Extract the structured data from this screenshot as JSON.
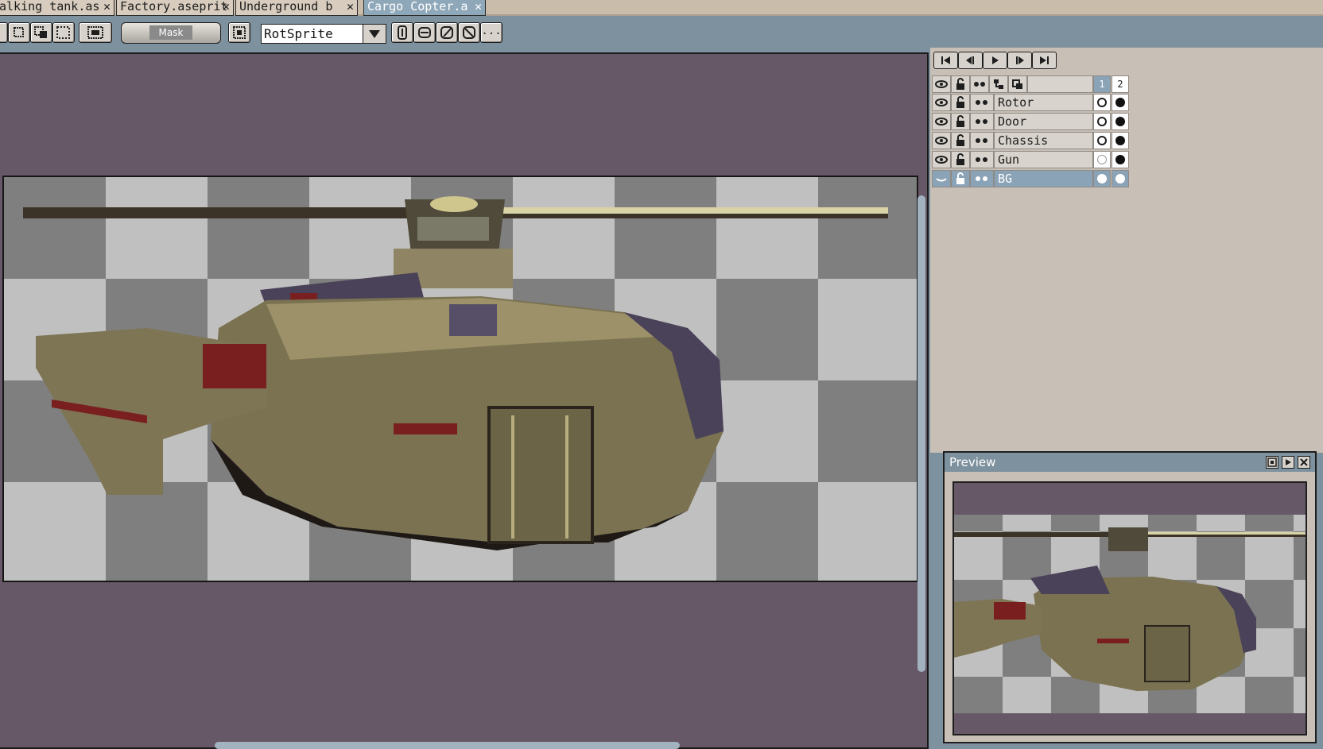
{
  "tabs": [
    {
      "label": "alking tank.as"
    },
    {
      "label": "Factory.aseprit"
    },
    {
      "label": "Underground b"
    },
    {
      "label": "Cargo Copter.a"
    }
  ],
  "close_glyph": "✕",
  "toolbar": {
    "mask_label": "Mask",
    "rotation_algorithm": "RotSprite",
    "more_label": "..."
  },
  "playback": [
    "first-frame-icon",
    "previous-frame-icon",
    "play-icon",
    "next-frame-icon",
    "last-frame-icon"
  ],
  "frames": [
    "1",
    "2"
  ],
  "layers": [
    {
      "name": "Rotor",
      "cels": [
        "filled-white",
        "filled-black"
      ]
    },
    {
      "name": "Door",
      "cels": [
        "filled-white",
        "filled-black"
      ]
    },
    {
      "name": "Chassis",
      "cels": [
        "filled-white",
        "filled-black"
      ]
    },
    {
      "name": "Gun",
      "cels": [
        "empty",
        "filled-black"
      ]
    },
    {
      "name": "BG",
      "cels": [
        "filled-white",
        "filled-white"
      ],
      "selected": true,
      "hidden": true
    }
  ],
  "preview": {
    "title": "Preview"
  },
  "colors": {
    "chrome": "#7d919e",
    "canvas_bg": "#675867",
    "checker_light": "#c0c0c0",
    "checker_dark": "#7f7f7f",
    "selection": "#8aa3b6"
  }
}
